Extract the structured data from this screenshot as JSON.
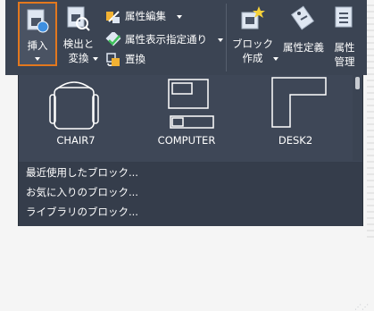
{
  "ribbon": {
    "insert": {
      "label": "挿入",
      "icon": "insert-block-icon"
    },
    "detect": {
      "line1": "検出と",
      "line2": "変換",
      "icon": "detect-convert-icon"
    },
    "edit_attr": {
      "label": "属性編集",
      "icon": "edit-attribute-icon"
    },
    "attr_display": {
      "label": "属性表示指定通り",
      "icon": "attribute-display-icon"
    },
    "replace": {
      "label": "置換",
      "icon": "replace-icon"
    },
    "create_block": {
      "line1": "ブロック",
      "line2": "作成",
      "icon": "create-block-icon"
    },
    "define_attr": {
      "label": "属性定義",
      "icon": "define-attribute-icon"
    },
    "manage_attr": {
      "line1": "属性",
      "line2": "管理",
      "icon": "manage-attribute-icon"
    }
  },
  "gallery": {
    "items": [
      {
        "name": "CHAIR7",
        "icon": "chair-block-icon"
      },
      {
        "name": "COMPUTER",
        "icon": "computer-block-icon"
      },
      {
        "name": "DESK2",
        "icon": "desk-block-icon"
      }
    ]
  },
  "menu": {
    "recent": "最近使用したブロック...",
    "favorites": "お気に入りのブロック...",
    "library": "ライブラリのブロック..."
  },
  "colors": {
    "ribbon_bg": "#3b4453",
    "panel_bg": "#3e4757",
    "highlight": "#e3781e"
  }
}
